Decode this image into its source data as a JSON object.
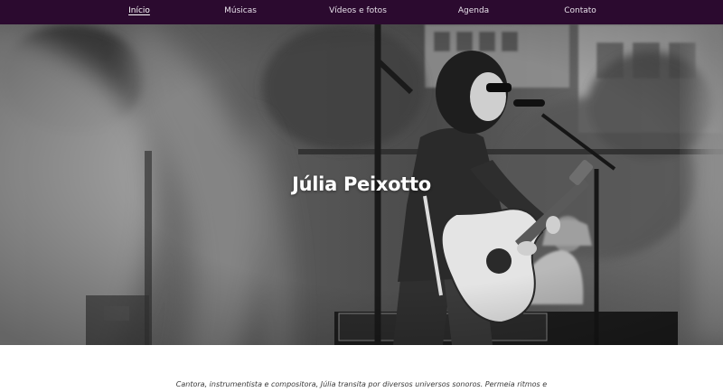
{
  "nav": {
    "items": [
      {
        "label": "Início",
        "active": true
      },
      {
        "label": "Músicas",
        "active": false
      },
      {
        "label": "Vídeos e fotos",
        "active": false
      },
      {
        "label": "Agenda",
        "active": false
      },
      {
        "label": "Contato",
        "active": false
      }
    ],
    "background": "#2b0a2f"
  },
  "hero": {
    "title": "Júlia Peixotto",
    "photo": "black-and-white photo of a singer playing acoustic guitar at a microphone on an outdoor stage"
  },
  "bio": {
    "text": "Cantora, instrumentista e compositora, Júlia transita por diversos universos sonoros. Permeia ritmos e"
  }
}
